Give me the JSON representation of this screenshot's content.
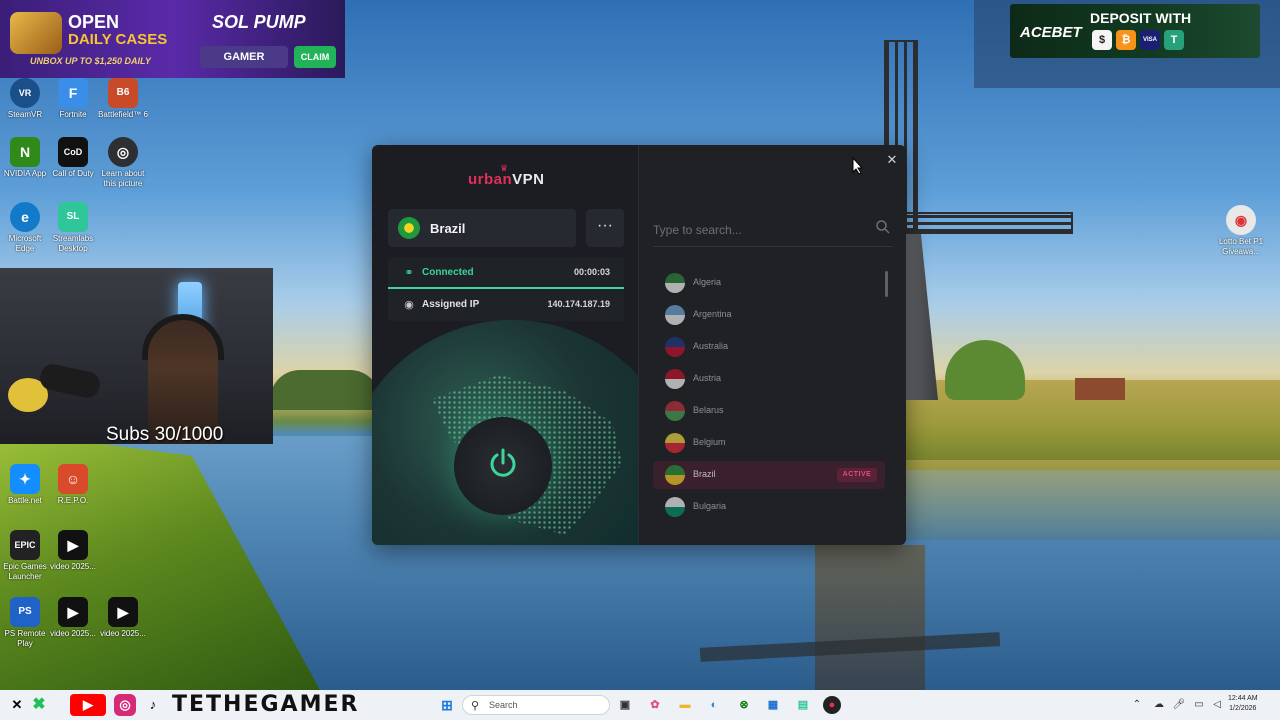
{
  "ads": {
    "left": {
      "line1": "OPEN",
      "line2": "DAILY CASES",
      "tagline": "UNBOX UP TO $1,250 DAILY",
      "brand": "SOL PUMP",
      "gamer_btn": "GAMER",
      "claim_btn": "CLAIM"
    },
    "right": {
      "brand": "ACEBET",
      "headline": "DEPOSIT WITH",
      "coins": [
        "$",
        "₿",
        "VISA",
        "T"
      ]
    }
  },
  "desktop_icons": [
    {
      "name": "SteamVR",
      "glyph": "VR",
      "color": "#1b4f8a"
    },
    {
      "name": "Fortnite",
      "glyph": "F",
      "color": "#3b8ee8"
    },
    {
      "name": "Battlefield™ 6",
      "glyph": "B6",
      "color": "#c84a28"
    },
    {
      "name": "NVIDIA App",
      "glyph": "N",
      "color": "#2f8a1a"
    },
    {
      "name": "Call of Duty",
      "glyph": "CoD",
      "color": "#111111"
    },
    {
      "name": "Learn about this picture",
      "glyph": "◎",
      "color": "#2d2f33"
    },
    {
      "name": "Microsoft Edge",
      "glyph": "e",
      "color": "#1379c9"
    },
    {
      "name": "Streamlabs Desktop",
      "glyph": "SL",
      "color": "#2fc69a"
    },
    {
      "name": "Battle.net",
      "glyph": "✦",
      "color": "#148eff"
    },
    {
      "name": "R.E.P.O.",
      "glyph": "☺",
      "color": "#d84a2a"
    },
    {
      "name": "Epic Games Launcher",
      "glyph": "EPIC",
      "color": "#222222"
    },
    {
      "name": "video 2025...",
      "glyph": "▶",
      "color": "#111111"
    },
    {
      "name": "PS Remote Play",
      "glyph": "PS",
      "color": "#1f63c8"
    },
    {
      "name": "video 2025...",
      "glyph": "▶",
      "color": "#111111"
    },
    {
      "name": "video 2025...",
      "glyph": "▶",
      "color": "#111111"
    },
    {
      "name": "Lotto Bet P1 Giveawa...",
      "glyph": "◉",
      "color": "#e8e8e8"
    }
  ],
  "webcam": {
    "overlay_text": "Subs 30/1000"
  },
  "vpn": {
    "logo_brand": "urban",
    "logo_suffix": "VPN",
    "location": "Brazil",
    "more_label": "···",
    "status_label": "Connected",
    "timer": "00:00:03",
    "ip_label": "Assigned IP",
    "ip_value": "140.174.187.19",
    "close_label": "✕",
    "search_placeholder": "Type to search...",
    "countries": [
      {
        "name": "Algeria",
        "active": false,
        "colors": [
          "#2f8a3a",
          "#ffffff"
        ]
      },
      {
        "name": "Argentina",
        "active": false,
        "colors": [
          "#74acdf",
          "#ffffff"
        ]
      },
      {
        "name": "Australia",
        "active": false,
        "colors": [
          "#1f3a8a",
          "#c8102e"
        ]
      },
      {
        "name": "Austria",
        "active": false,
        "colors": [
          "#c8102e",
          "#ffffff"
        ]
      },
      {
        "name": "Belarus",
        "active": false,
        "colors": [
          "#c8313e",
          "#4aa657"
        ]
      },
      {
        "name": "Belgium",
        "active": false,
        "colors": [
          "#fae042",
          "#ed2939"
        ]
      },
      {
        "name": "Brazil",
        "active": true,
        "badge": "ACTIVE",
        "colors": [
          "#1e9a3c",
          "#f5d425"
        ]
      },
      {
        "name": "Bulgaria",
        "active": false,
        "colors": [
          "#ffffff",
          "#00966e"
        ]
      }
    ]
  },
  "taskbar": {
    "channel_name": "TETHEGAMER",
    "search_label": "Search",
    "time": "12:44 AM",
    "date": "1/2/2026"
  },
  "colors": {
    "accent_green": "#3bd69a",
    "brand_pink": "#e0305a",
    "vpn_bg": "#1b1d22"
  }
}
